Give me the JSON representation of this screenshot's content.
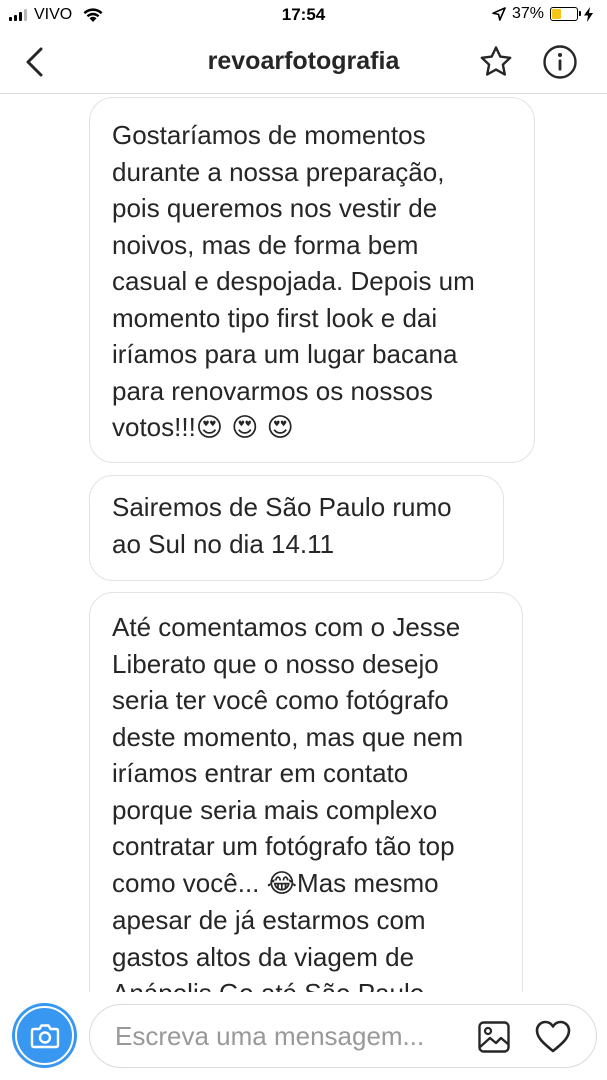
{
  "status_bar": {
    "carrier": "VIVO",
    "time": "17:54",
    "battery_percent": "37%",
    "battery_level": 0.37,
    "battery_color": "#f5c518",
    "icons": [
      "signal-icon",
      "wifi-icon",
      "location-arrow-icon",
      "battery-icon",
      "charging-bolt-icon"
    ]
  },
  "nav": {
    "title": "revoarfotografia",
    "icons": [
      "chevron-left-icon",
      "star-icon",
      "info-icon"
    ]
  },
  "messages": [
    {
      "lines": [
        "Gostaríamos de momentos",
        "durante a nossa preparação,",
        "pois queremos nos vestir de",
        "noivos, mas de forma bem",
        "casual e despojada. Depois um",
        "momento tipo first look e dai",
        "iríamos  para um lugar bacana",
        "para renovarmos os nossos",
        "votos!!!"
      ],
      "emoji_suffix": "😍 😍 😍"
    },
    {
      "lines": [
        "Sairemos de São Paulo rumo",
        "ao Sul no dia 14.11"
      ]
    },
    {
      "lines": [
        "Até comentamos com o Jesse",
        "Liberato que o nosso desejo",
        "seria ter você como fotógrafo",
        "deste momento, mas que nem",
        "iríamos entrar em contato",
        "porque seria mais complexo",
        "contratar um fotógrafo tão top",
        "como você...",
        "apesar de já estarmos com",
        "gastos altos da viagem de",
        "Anápolis Go até São Paulo"
      ],
      "inline_emoji": "😂",
      "inline_after": "Mas mesmo"
    }
  ],
  "composer": {
    "placeholder": "Escreva uma mensagem...",
    "accent_color": "#3897f0",
    "icons": [
      "camera-icon",
      "gallery-icon",
      "heart-icon"
    ]
  }
}
